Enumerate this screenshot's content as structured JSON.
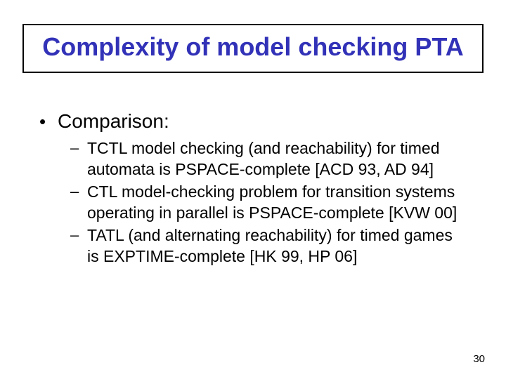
{
  "title": "Complexity of model checking PTA",
  "comparison_label": "Comparison:",
  "items": [
    "TCTL model checking (and reachability) for timed automata is PSPACE-complete [ACD 93, AD 94]",
    "CTL model-checking problem for transition systems operating in parallel is PSPACE-complete [KVW 00]",
    "TATL (and alternating reachability) for timed games is EXPTIME-complete [HK 99, HP 06]"
  ],
  "page_number": "30",
  "bullets": {
    "level1": "•",
    "level2": "–"
  }
}
